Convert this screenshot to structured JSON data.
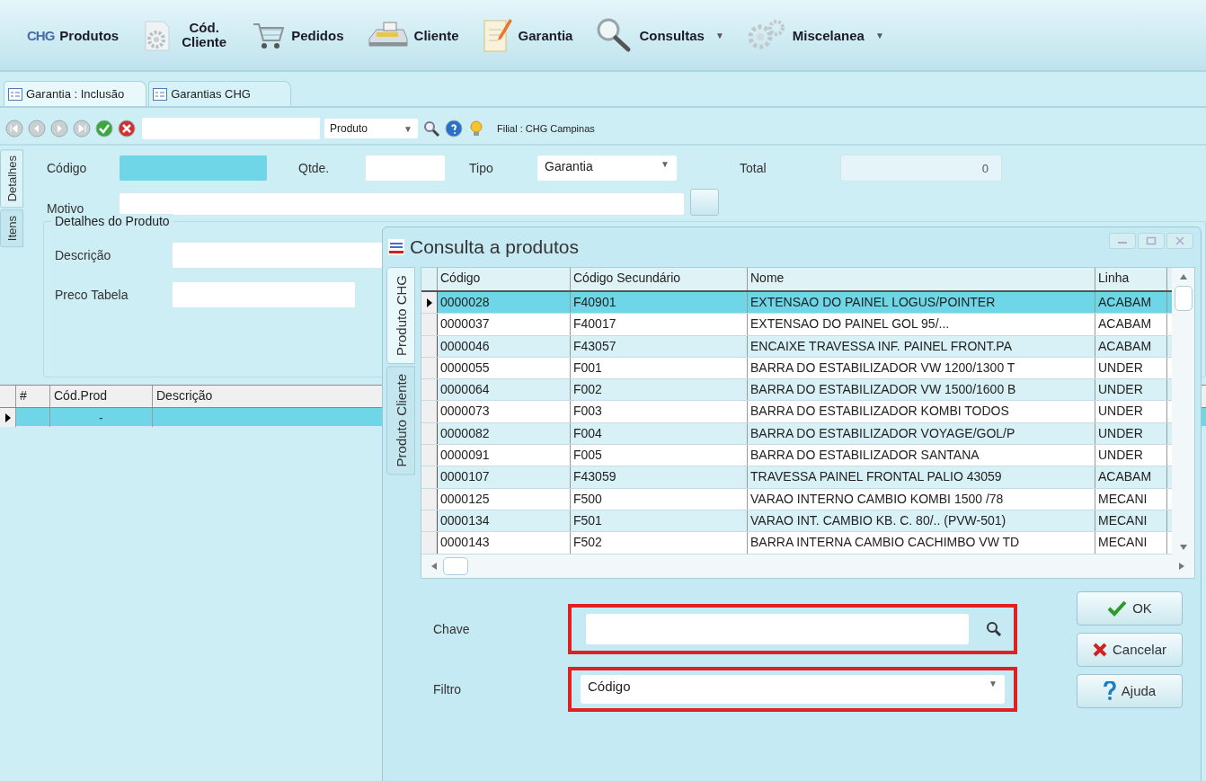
{
  "toolbar": [
    {
      "label": "Produtos",
      "logo_text": "CHG"
    },
    {
      "label": "Cód. Cliente"
    },
    {
      "label": "Pedidos"
    },
    {
      "label": "Cliente"
    },
    {
      "label": "Garantia"
    },
    {
      "label": "Consultas",
      "arrow": "▼"
    },
    {
      "label": "Miscelanea",
      "arrow": "▼"
    }
  ],
  "doc_tabs": [
    {
      "label": "Garantia : Inclusão",
      "selected": true
    },
    {
      "label": "Garantias CHG",
      "selected": false
    }
  ],
  "nav_bar": {
    "field_type": "Produto",
    "filial": "Filial : CHG Campinas"
  },
  "side_tabs": [
    {
      "label": "Detalhes",
      "selected": true
    },
    {
      "label": "Itens",
      "selected": false
    }
  ],
  "form": {
    "codigo_label": "Código",
    "qtde_label": "Qtde.",
    "tipo_label": "Tipo",
    "tipo_value": "Garantia",
    "total_label": "Total",
    "total_value": "0",
    "motivo_label": "Motivo"
  },
  "product_group": {
    "title": "Detalhes do Produto",
    "descricao_label": "Descrição",
    "preco_label": "Preco Tabela"
  },
  "items_grid": {
    "columns": [
      "#",
      "Cód.Prod",
      "Descrição"
    ],
    "rows": [
      {
        "cod": "-",
        "selected": true
      }
    ]
  },
  "dialog": {
    "title": "Consulta a produtos",
    "side_tabs": [
      {
        "label": "Produto CHG",
        "selected": true
      },
      {
        "label": "Produto Cliente",
        "selected": false
      }
    ],
    "table": {
      "columns": [
        "Código",
        "Código Secundário",
        "Nome",
        "Linha"
      ],
      "rows": [
        {
          "cells": [
            "0000028",
            "F40901",
            "EXTENSAO DO PAINEL LOGUS/POINTER",
            "ACABAM"
          ],
          "selected": true
        },
        {
          "cells": [
            "0000037",
            "F40017",
            "EXTENSAO DO PAINEL GOL 95/...",
            "ACABAM"
          ],
          "selected": false
        },
        {
          "cells": [
            "0000046",
            "F43057",
            "ENCAIXE TRAVESSA INF. PAINEL FRONT.PA",
            "ACABAM"
          ],
          "selected": false
        },
        {
          "cells": [
            "0000055",
            "F001",
            "BARRA DO ESTABILIZADOR VW 1200/1300 T",
            "UNDER"
          ],
          "selected": false
        },
        {
          "cells": [
            "0000064",
            "F002",
            "BARRA DO ESTABILIZADOR VW 1500/1600 B",
            "UNDER"
          ],
          "selected": false
        },
        {
          "cells": [
            "0000073",
            "F003",
            "BARRA DO ESTABILIZADOR KOMBI TODOS",
            "UNDER"
          ],
          "selected": false
        },
        {
          "cells": [
            "0000082",
            "F004",
            "BARRA DO ESTABILIZADOR VOYAGE/GOL/P",
            "UNDER"
          ],
          "selected": false
        },
        {
          "cells": [
            "0000091",
            "F005",
            "BARRA DO ESTABILIZADOR SANTANA",
            "UNDER"
          ],
          "selected": false
        },
        {
          "cells": [
            "0000107",
            "F43059",
            "TRAVESSA PAINEL FRONTAL PALIO  43059",
            "ACABAM"
          ],
          "selected": false
        },
        {
          "cells": [
            "0000125",
            "F500",
            "VARAO INTERNO CAMBIO KOMBI 1500 /78",
            "MECANI"
          ],
          "selected": false
        },
        {
          "cells": [
            "0000134",
            "F501",
            "VARAO INT. CAMBIO KB. C. 80/.. (PVW-501)",
            "MECANI"
          ],
          "selected": false
        },
        {
          "cells": [
            "0000143",
            "F502",
            "BARRA INTERNA CAMBIO CACHIMBO VW TD",
            "MECANI"
          ],
          "selected": false
        }
      ]
    },
    "chave_label": "Chave",
    "filtro_label": "Filtro",
    "filtro_value": "Código",
    "buttons": [
      {
        "label": "OK",
        "kind": "ok"
      },
      {
        "label": "Cancelar",
        "kind": "cancel"
      },
      {
        "label": "Ajuda",
        "kind": "help"
      }
    ]
  }
}
